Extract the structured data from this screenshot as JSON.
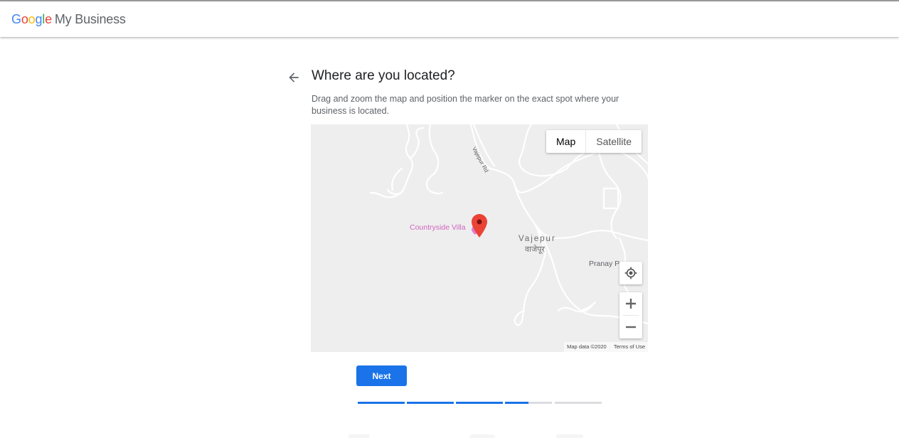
{
  "app": {
    "logo_letters": [
      {
        "ch": "G",
        "color": "#4285F4"
      },
      {
        "ch": "o",
        "color": "#EA4335"
      },
      {
        "ch": "o",
        "color": "#FBBC05"
      },
      {
        "ch": "g",
        "color": "#4285F4"
      },
      {
        "ch": "l",
        "color": "#34A853"
      },
      {
        "ch": "e",
        "color": "#EA4335"
      }
    ],
    "product_name": "My Business"
  },
  "page": {
    "back_icon": "arrow-left-icon",
    "title": "Where are you located?",
    "description": "Drag and zoom the map and position the marker on the exact spot where your business is located."
  },
  "map": {
    "type_buttons": {
      "map": "Map",
      "satellite": "Satellite",
      "active": "map"
    },
    "marker_label": "Countryside Villa",
    "town_name": "Vajepur",
    "town_name_local": "वाजेपूर",
    "poi_name": "Pranay Pr",
    "road_label": "Vajepur Rd",
    "attribution": {
      "data": "Map data ©2020",
      "terms": "Terms of Use"
    },
    "icons": {
      "locate": "my-location-icon",
      "zoom_in": "plus-icon",
      "zoom_out": "minus-icon",
      "marker": "map-pin-icon"
    },
    "marker_color": "#EA4335"
  },
  "actions": {
    "next_label": "Next"
  },
  "progress": {
    "segments": [
      1,
      1,
      1,
      0.5,
      0
    ],
    "accent": "#1a73e8"
  }
}
